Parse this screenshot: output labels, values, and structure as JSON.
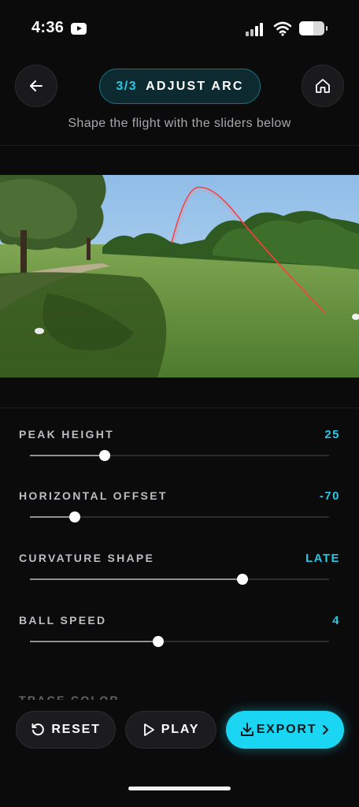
{
  "status": {
    "time": "4:36"
  },
  "header": {
    "step_count": "3/3",
    "step_title": "ADJUST ARC",
    "subtitle": "Shape the flight with the sliders below"
  },
  "sliders": [
    {
      "label": "PEAK HEIGHT",
      "value": "25",
      "position": 0.25
    },
    {
      "label": "HORIZONTAL OFFSET",
      "value": "-70",
      "position": 0.15
    },
    {
      "label": "CURVATURE SHAPE",
      "value": "LATE",
      "position": 0.71
    },
    {
      "label": "BALL SPEED",
      "value": "4",
      "position": 0.43
    }
  ],
  "partial_label": "TRACE COLOR",
  "actions": {
    "reset": "RESET",
    "play": "PLAY",
    "export": "EXPORT"
  },
  "colors": {
    "accent": "#1ad6f2",
    "trace": "#ff3b3b"
  }
}
